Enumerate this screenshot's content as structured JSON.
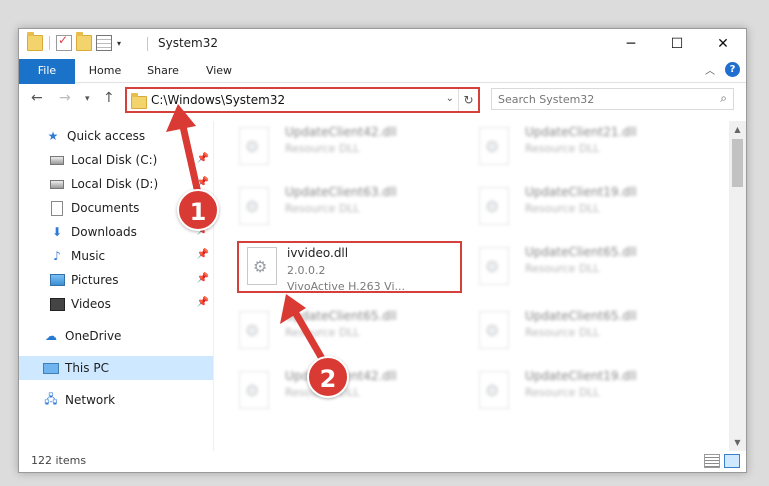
{
  "window": {
    "title": "System32",
    "controls": {
      "minimize": "─",
      "maximize": "☐",
      "close": "✕"
    }
  },
  "ribbon": {
    "tabs": [
      "File",
      "Home",
      "Share",
      "View"
    ],
    "help": "?"
  },
  "address": {
    "path": "C:\\Windows\\System32",
    "search_placeholder": "Search System32"
  },
  "sidebar": {
    "items": [
      {
        "label": "Quick access",
        "icon": "star-icon",
        "pinned": false
      },
      {
        "label": "Local Disk (C:)",
        "icon": "disk-icon",
        "pinned": true
      },
      {
        "label": "Local Disk (D:)",
        "icon": "disk-icon",
        "pinned": true
      },
      {
        "label": "Documents",
        "icon": "document-icon",
        "pinned": true
      },
      {
        "label": "Downloads",
        "icon": "download-icon",
        "pinned": true
      },
      {
        "label": "Music",
        "icon": "music-icon",
        "pinned": true
      },
      {
        "label": "Pictures",
        "icon": "pictures-icon",
        "pinned": true
      },
      {
        "label": "Videos",
        "icon": "videos-icon",
        "pinned": true
      },
      {
        "label": "OneDrive",
        "icon": "cloud-icon",
        "pinned": false
      },
      {
        "label": "This PC",
        "icon": "pc-icon",
        "pinned": false,
        "selected": true
      },
      {
        "label": "Network",
        "icon": "network-icon",
        "pinned": false
      }
    ]
  },
  "files": [
    {
      "name": "UpdateClient42.dll",
      "sub": "Resource DLL"
    },
    {
      "name": "UpdateClient21.dll",
      "sub": "Resource DLL"
    },
    {
      "name": "UpdateClient63.dll",
      "sub": "Resource DLL"
    },
    {
      "name": "UpdateClient19.dll",
      "sub": "Resource DLL"
    },
    {
      "name": "ivvideo.dll",
      "sub": "2.0.0.2",
      "sub2": "VivoActive H.263 Vi..."
    },
    {
      "name": "UpdateClient65.dll",
      "sub": "Resource DLL"
    },
    {
      "name": "UpdateClient65.dll",
      "sub": "Resource DLL"
    },
    {
      "name": "UpdateClient65.dll",
      "sub": "Resource DLL"
    },
    {
      "name": "UpdateClient42.dll",
      "sub": "Resource DLL"
    },
    {
      "name": "UpdateClient19.dll",
      "sub": "Resource DLL"
    }
  ],
  "status": {
    "items": "122 items"
  },
  "annotations": {
    "step1": "1",
    "step2": "2",
    "color": "#d93a33"
  }
}
